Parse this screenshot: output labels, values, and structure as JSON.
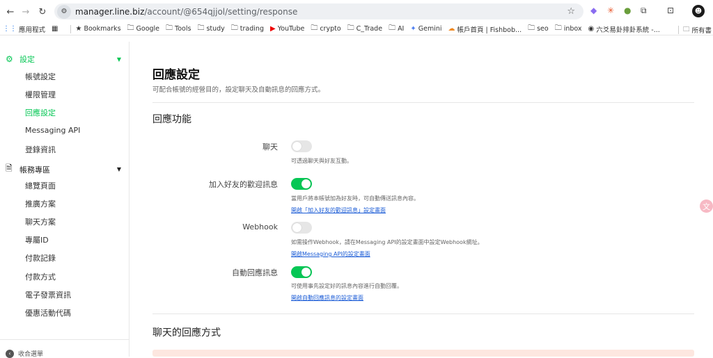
{
  "browser": {
    "url_host": "manager.line.biz",
    "url_path": "/account/@654qjjol/setting/response",
    "bookmarks": [
      "應用程式",
      "Bookmarks",
      "Google",
      "Tools",
      "study",
      "trading",
      "YouTube",
      "crypto",
      "C_Trade",
      "AI",
      "Gemini",
      "帳戶首頁 | Fishbob...",
      "seo",
      "inbox",
      "六爻易卦排卦系統 -..."
    ],
    "bookmarks_right": "所有書"
  },
  "sidebar": {
    "settings_group": "設定",
    "settings_items": [
      "帳號設定",
      "權限管理",
      "回應設定",
      "Messaging API",
      "登錄資訊"
    ],
    "billing_group": "帳務專區",
    "billing_items": [
      "總覽頁面",
      "推廣方案",
      "聊天方案",
      "專屬ID",
      "付款記錄",
      "付款方式",
      "電子發票資訊",
      "優惠活動代碼"
    ],
    "collapse_label": "收合選單"
  },
  "main": {
    "title": "回應設定",
    "description": "可配合帳號的經營目的，設定聊天及自動訊息的回應方式。",
    "section1_title": "回應功能",
    "rows": [
      {
        "label": "聊天",
        "on": false,
        "desc": "可透過聊天與好友互動。",
        "link": ""
      },
      {
        "label": "加入好友的歡迎訊息",
        "on": true,
        "desc": "當用戶將本帳號加為好友時，可自動傳送訊息內容。",
        "link": "開啟「加入好友的歡迎訊息」設定畫面"
      },
      {
        "label": "Webhook",
        "on": false,
        "desc": "如需操作Webhook，請在Messaging API的設定畫面中設定Webhook網址。",
        "link": "開啟Messaging API的設定畫面"
      },
      {
        "label": "自動回應訊息",
        "on": true,
        "desc": "可使用事先設定好的訊息內容進行自動回覆。",
        "link": "開啟自動回應訊息的設定畫面"
      }
    ],
    "section2_title": "聊天的回應方式"
  },
  "colors": {
    "accent": "#06c755",
    "link": "#1a5bd6"
  }
}
